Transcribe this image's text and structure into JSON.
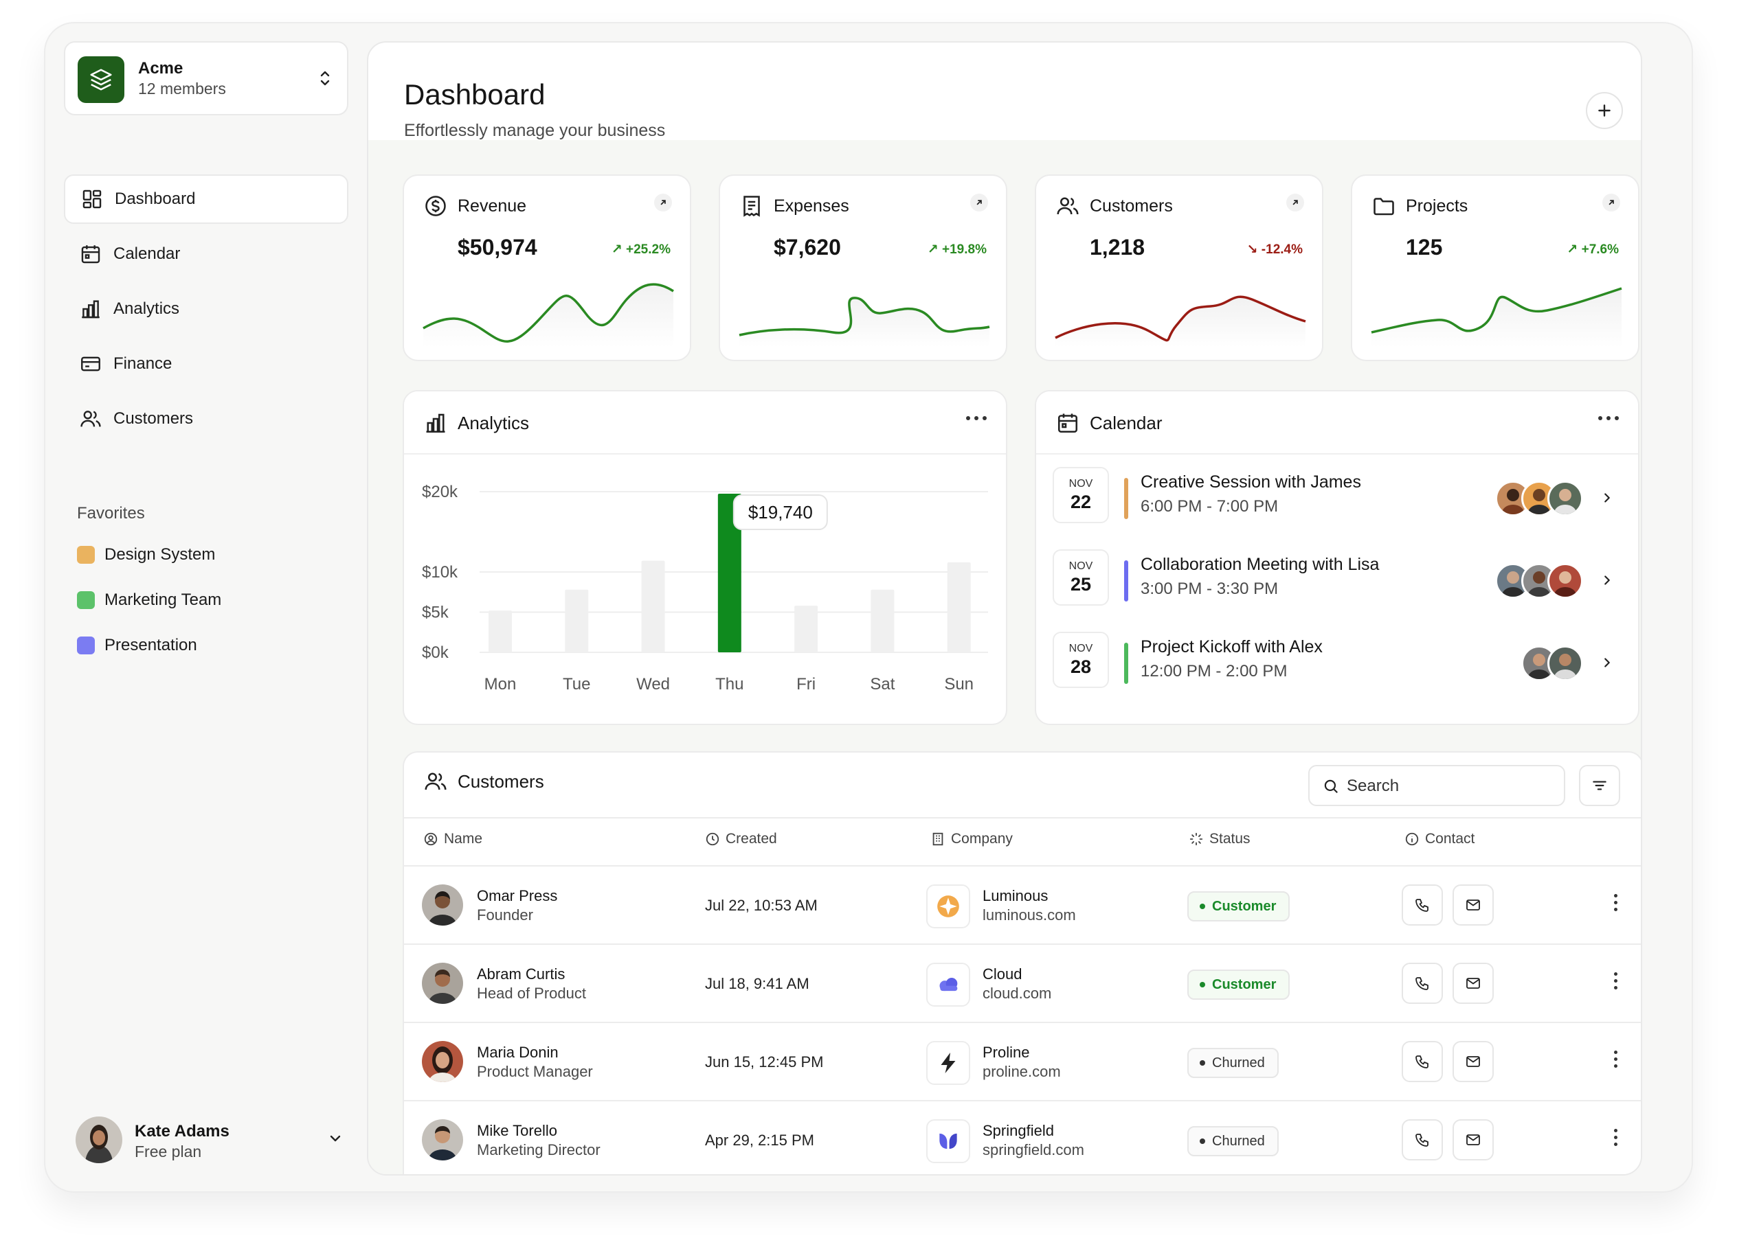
{
  "org": {
    "name": "Acme",
    "members": "12 members"
  },
  "nav": {
    "items": [
      {
        "label": "Dashboard",
        "icon": "dashboard-icon",
        "active": true
      },
      {
        "label": "Calendar",
        "icon": "calendar-icon"
      },
      {
        "label": "Analytics",
        "icon": "analytics-icon"
      },
      {
        "label": "Finance",
        "icon": "finance-icon"
      },
      {
        "label": "Customers",
        "icon": "customers-icon"
      }
    ]
  },
  "favorites": {
    "title": "Favorites",
    "items": [
      {
        "label": "Design System",
        "color": "#eab35f"
      },
      {
        "label": "Marketing Team",
        "color": "#5cc26a"
      },
      {
        "label": "Presentation",
        "color": "#7b7cf2"
      }
    ]
  },
  "user": {
    "name": "Kate Adams",
    "plan": "Free plan"
  },
  "header": {
    "title": "Dashboard",
    "subtitle": "Effortlessly manage your business"
  },
  "stats": [
    {
      "title": "Revenue",
      "value": "$50,974",
      "change": "+25.2%",
      "trend": "up",
      "color": "#2a8a22"
    },
    {
      "title": "Expenses",
      "value": "$7,620",
      "change": "+19.8%",
      "trend": "up",
      "color": "#2a8a22"
    },
    {
      "title": "Customers",
      "value": "1,218",
      "change": "-12.4%",
      "trend": "down",
      "color": "#9b1c14"
    },
    {
      "title": "Projects",
      "value": "125",
      "change": "+7.6%",
      "trend": "up",
      "color": "#2a8a22"
    }
  ],
  "analytics": {
    "title": "Analytics"
  },
  "chart_data": {
    "type": "bar",
    "categories": [
      "Mon",
      "Tue",
      "Wed",
      "Thu",
      "Fri",
      "Sat",
      "Sun"
    ],
    "values": [
      5200,
      7800,
      11400,
      19740,
      5800,
      7800,
      11200
    ],
    "highlight_index": 3,
    "highlight_label": "$19,740",
    "yticks": [
      {
        "label": "$20k",
        "value": 20000
      },
      {
        "label": "$10k",
        "value": 10000
      },
      {
        "label": "$5k",
        "value": 5000
      },
      {
        "label": "$0k",
        "value": 0
      }
    ],
    "colors": {
      "bar": "#f0f0f0",
      "highlight": "#0f8a1e"
    },
    "title": "",
    "xlabel": "",
    "ylabel": ""
  },
  "calendar": {
    "title": "Calendar",
    "events": [
      {
        "month": "NOV",
        "day": "22",
        "title": "Creative Session with James",
        "time": "6:00 PM - 7:00 PM",
        "color": "#e0a25a",
        "attendees": 3
      },
      {
        "month": "NOV",
        "day": "25",
        "title": "Collaboration Meeting with Lisa",
        "time": "3:00 PM - 3:30 PM",
        "color": "#6d6df0",
        "attendees": 3
      },
      {
        "month": "NOV",
        "day": "28",
        "title": "Project Kickoff with Alex",
        "time": "12:00 PM - 2:00 PM",
        "color": "#4cb95c",
        "attendees": 2
      }
    ]
  },
  "customers": {
    "title": "Customers",
    "search_placeholder": "Search",
    "columns": [
      "Name",
      "Created",
      "Company",
      "Status",
      "Contact"
    ],
    "rows": [
      {
        "name": "Omar Press",
        "role": "Founder",
        "created": "Jul 22, 10:53 AM",
        "company": "Luminous",
        "url": "luminous.com",
        "status": "Customer",
        "logo": "luminous-logo-icon"
      },
      {
        "name": "Abram Curtis",
        "role": "Head of Product",
        "created": "Jul 18, 9:41 AM",
        "company": "Cloud",
        "url": "cloud.com",
        "status": "Customer",
        "logo": "cloud-logo-icon"
      },
      {
        "name": "Maria Donin",
        "role": "Product Manager",
        "created": "Jun 15, 12:45 PM",
        "company": "Proline",
        "url": "proline.com",
        "status": "Churned",
        "logo": "proline-logo-icon"
      },
      {
        "name": "Mike Torello",
        "role": "Marketing Director",
        "created": "Apr 29, 2:15 PM",
        "company": "Springfield",
        "url": "springfield.com",
        "status": "Churned",
        "logo": "springfield-logo-icon"
      }
    ]
  }
}
